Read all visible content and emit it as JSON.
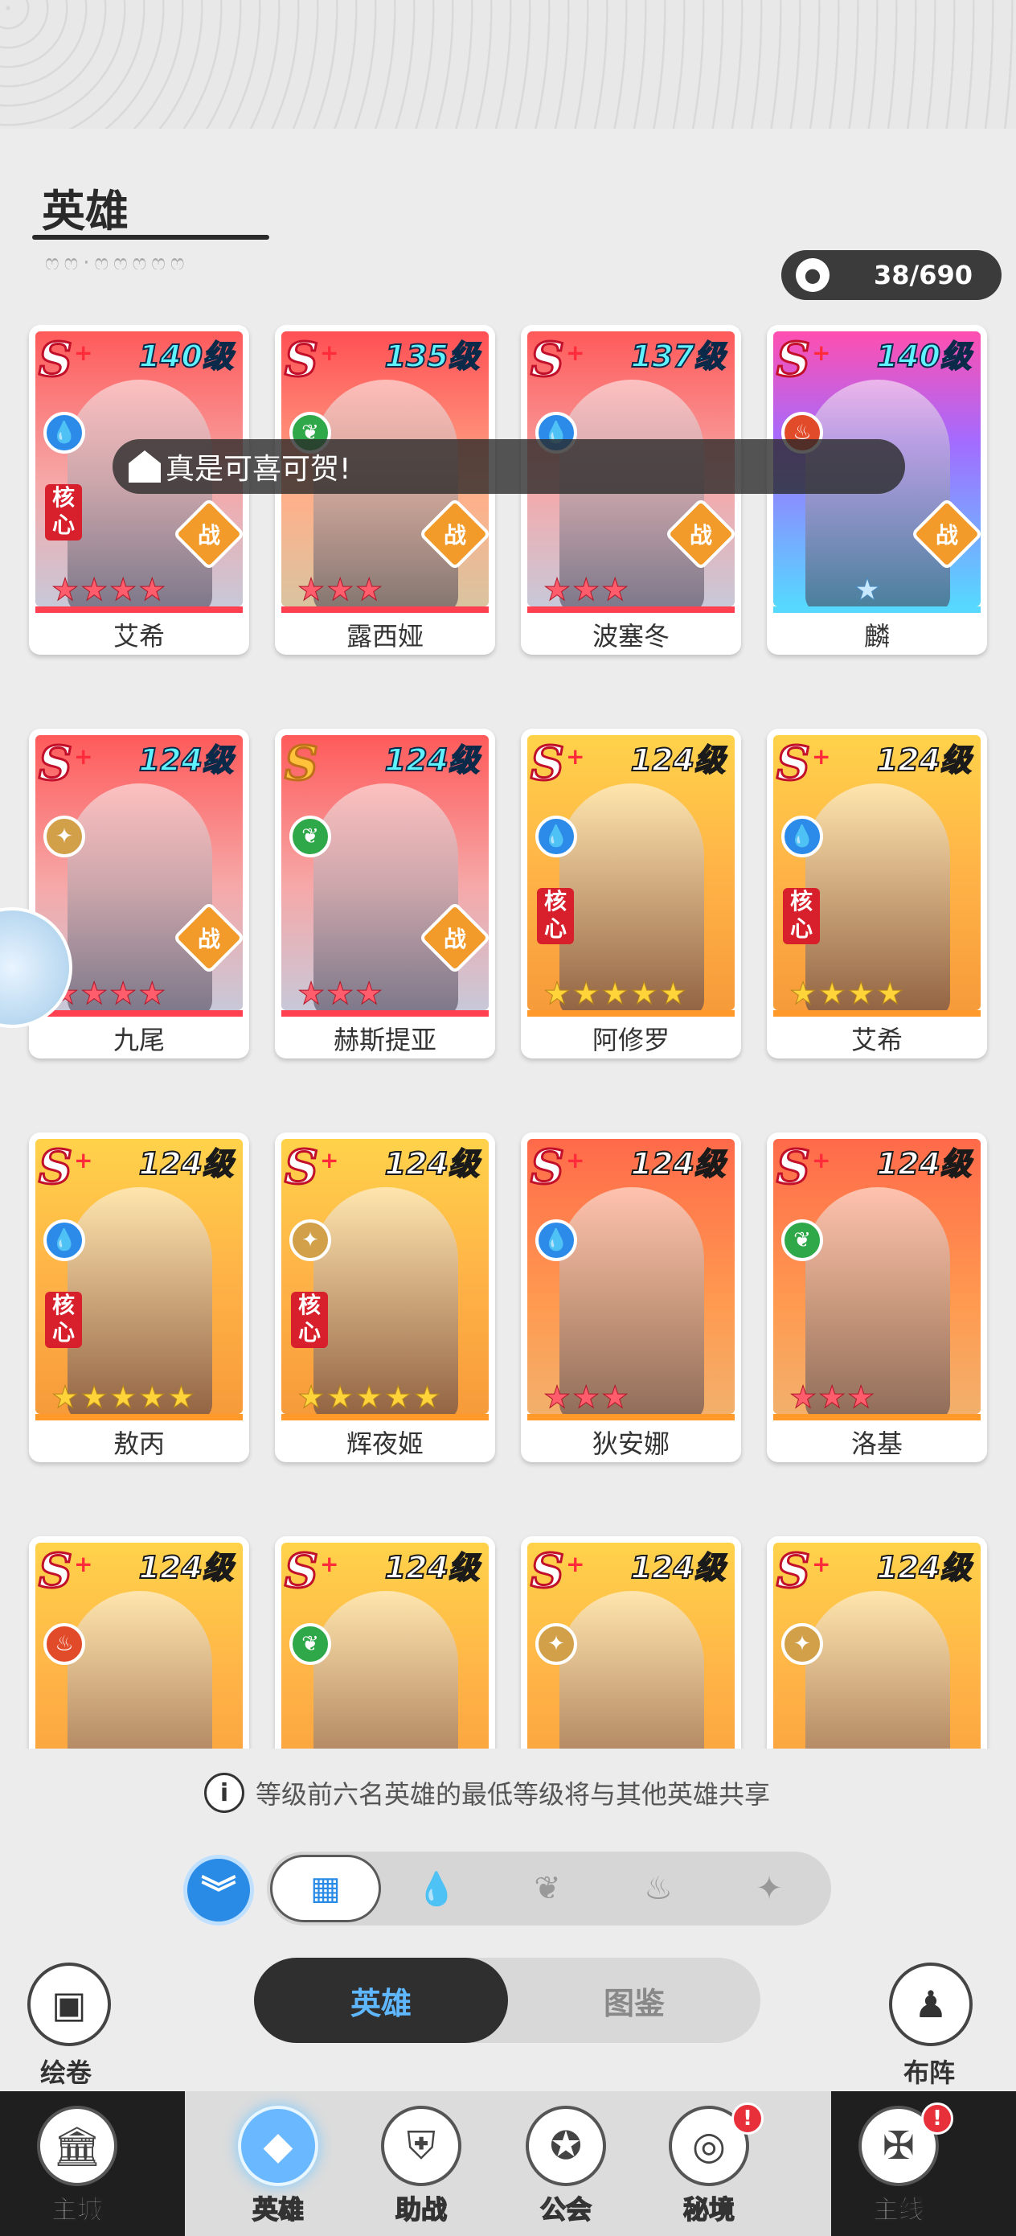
{
  "header": {
    "title": "英雄",
    "subtitle_deco": "ෆෆ·ෆෆෆෆෆ",
    "hero_count": "38/690",
    "count_icon": "hero-silhouette-icon"
  },
  "toast": {
    "text": "真是可喜可贺!"
  },
  "heroes": [
    {
      "name": "艾希",
      "level": "140级",
      "rank": "S",
      "plus": "+",
      "element": "water",
      "core": true,
      "war": true,
      "stars": 4,
      "star_color": "red",
      "art": "red"
    },
    {
      "name": "露西娅",
      "level": "135级",
      "rank": "S",
      "plus": "+",
      "element": "wood",
      "core": false,
      "war": true,
      "stars": 3,
      "star_color": "red",
      "art": "red2"
    },
    {
      "name": "波塞冬",
      "level": "137级",
      "rank": "S",
      "plus": "+",
      "element": "water",
      "core": false,
      "war": true,
      "stars": 3,
      "star_color": "red",
      "art": "red"
    },
    {
      "name": "麟",
      "level": "140级",
      "rank": "S",
      "plus": "+",
      "element": "fire",
      "core": false,
      "war": true,
      "stars": 1,
      "star_color": "blue",
      "art": "pink"
    },
    {
      "name": "九尾",
      "level": "124级",
      "rank": "S",
      "plus": "+",
      "element": "light",
      "core": false,
      "war": true,
      "stars": 4,
      "star_color": "red",
      "art": "red"
    },
    {
      "name": "赫斯提亚",
      "level": "124级",
      "rank": "S",
      "plus": "",
      "element": "wood",
      "core": false,
      "war": true,
      "stars": 3,
      "star_color": "red",
      "art": "red"
    },
    {
      "name": "阿修罗",
      "level": "124级",
      "rank": "S",
      "plus": "+",
      "element": "water",
      "core": true,
      "war": false,
      "stars": 5,
      "star_color": "gold",
      "art": "orange"
    },
    {
      "name": "艾希",
      "level": "124级",
      "rank": "S",
      "plus": "+",
      "element": "water",
      "core": true,
      "war": false,
      "stars": 4,
      "star_color": "gold",
      "art": "orange"
    },
    {
      "name": "敖丙",
      "level": "124级",
      "rank": "S",
      "plus": "+",
      "element": "water",
      "core": true,
      "war": false,
      "stars": 5,
      "star_color": "gold",
      "art": "orange"
    },
    {
      "name": "辉夜姬",
      "level": "124级",
      "rank": "S",
      "plus": "+",
      "element": "light",
      "core": true,
      "war": false,
      "stars": 5,
      "star_color": "gold",
      "art": "orange"
    },
    {
      "name": "狄安娜",
      "level": "124级",
      "rank": "S",
      "plus": "+",
      "element": "water",
      "core": false,
      "war": false,
      "stars": 3,
      "star_color": "red",
      "art": "orange-red"
    },
    {
      "name": "洛基",
      "level": "124级",
      "rank": "S",
      "plus": "+",
      "element": "wood",
      "core": false,
      "war": false,
      "stars": 3,
      "star_color": "red",
      "art": "orange-red"
    },
    {
      "name": "",
      "level": "124级",
      "rank": "S",
      "plus": "+",
      "element": "fire",
      "core": false,
      "war": false,
      "stars": 0,
      "star_color": "gold",
      "art": "orange"
    },
    {
      "name": "",
      "level": "124级",
      "rank": "S",
      "plus": "+",
      "element": "wood",
      "core": false,
      "war": false,
      "stars": 0,
      "star_color": "gold",
      "art": "orange"
    },
    {
      "name": "",
      "level": "124级",
      "rank": "S",
      "plus": "+",
      "element": "light",
      "core": false,
      "war": false,
      "stars": 0,
      "star_color": "gold",
      "art": "orange"
    },
    {
      "name": "",
      "level": "124级",
      "rank": "S",
      "plus": "+",
      "element": "light",
      "core": false,
      "war": false,
      "stars": 0,
      "star_color": "gold",
      "art": "orange"
    }
  ],
  "badges": {
    "core_line1": "核",
    "core_line2": "心",
    "war": "战"
  },
  "info": {
    "icon": "i",
    "text": "等级前六名英雄的最低等级将与其他英雄共享"
  },
  "filters": {
    "expand_icon": "double-chevron-down-icon",
    "items": [
      {
        "name": "all-filter",
        "glyph": "▦"
      },
      {
        "name": "water-filter",
        "glyph": "💧"
      },
      {
        "name": "wood-filter",
        "glyph": "❦"
      },
      {
        "name": "fire-filter",
        "glyph": "♨"
      },
      {
        "name": "light-filter",
        "glyph": "✦"
      }
    ]
  },
  "side": {
    "scroll_label": "绘卷",
    "formation_label": "布阵"
  },
  "tabs": {
    "heroes": "英雄",
    "codex": "图鉴"
  },
  "nav": {
    "items": [
      {
        "label": "主城",
        "alert": false
      },
      {
        "label": "英雄",
        "alert": false,
        "active": true
      },
      {
        "label": "助战",
        "alert": false
      },
      {
        "label": "公会",
        "alert": false
      },
      {
        "label": "秘境",
        "alert": true
      },
      {
        "label": "主线",
        "alert": true
      }
    ],
    "alert_mark": "!"
  },
  "colors": {
    "accent": "#2a8be6",
    "tab_active_text": "#5fb8ff",
    "alert": "#e8303a"
  }
}
